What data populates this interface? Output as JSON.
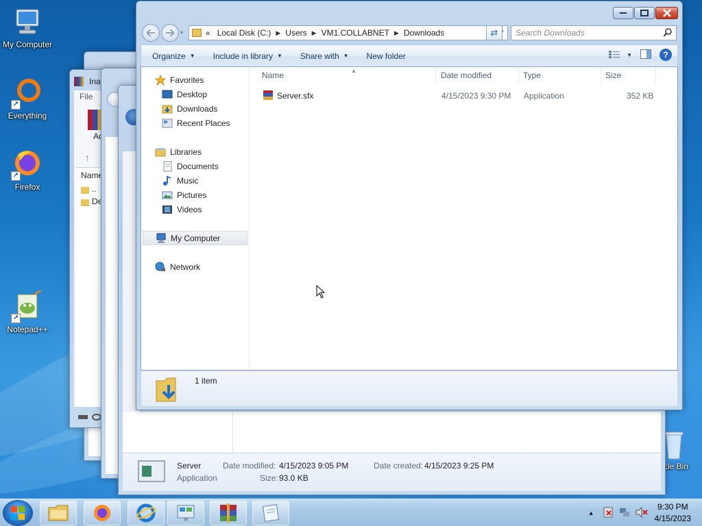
{
  "desktop": {
    "icons": [
      {
        "label": "My Computer"
      },
      {
        "label": "Everything"
      },
      {
        "label": "Firefox"
      },
      {
        "label": "Notepad++"
      },
      {
        "label": "cle Bin"
      }
    ]
  },
  "bg_windows": {
    "winrar_title": "Ina",
    "winrar_menu": "File",
    "winrar_tool": "Ad",
    "winrar_col": "Name",
    "winrar_rows": [
      "..",
      "De"
    ],
    "props_name": "Server",
    "props_type": "Application",
    "props_modified_label": "Date modified:",
    "props_modified_value": "4/15/2023 9:05 PM",
    "props_created_label": "Date created:",
    "props_created_value": "4/15/2023 9:25 PM",
    "props_size_label": "Size:",
    "props_size_value": "93.0 KB"
  },
  "explorer": {
    "breadcrumb": [
      "Local Disk (C:)",
      "Users",
      "VM1.COLLABNET",
      "Downloads"
    ],
    "breadcrumb_prefix": "«",
    "search_placeholder": "Search Downloads",
    "commands": [
      "Organize",
      "Include in library",
      "Share with",
      "New folder"
    ],
    "nav": {
      "favorites": "Favorites",
      "favorites_items": [
        "Desktop",
        "Downloads",
        "Recent Places"
      ],
      "libraries": "Libraries",
      "libraries_items": [
        "Documents",
        "Music",
        "Pictures",
        "Videos"
      ],
      "computer": "My Computer",
      "network": "Network"
    },
    "columns": [
      "Name",
      "Date modified",
      "Type",
      "Size"
    ],
    "files": [
      {
        "name": "Server.sfx",
        "modified": "4/15/2023 9:30 PM",
        "type": "Application",
        "size": "352 KB"
      }
    ],
    "item_count": "1 item"
  },
  "taskbar": {
    "time": "9:30 PM",
    "date": "4/15/2023"
  }
}
